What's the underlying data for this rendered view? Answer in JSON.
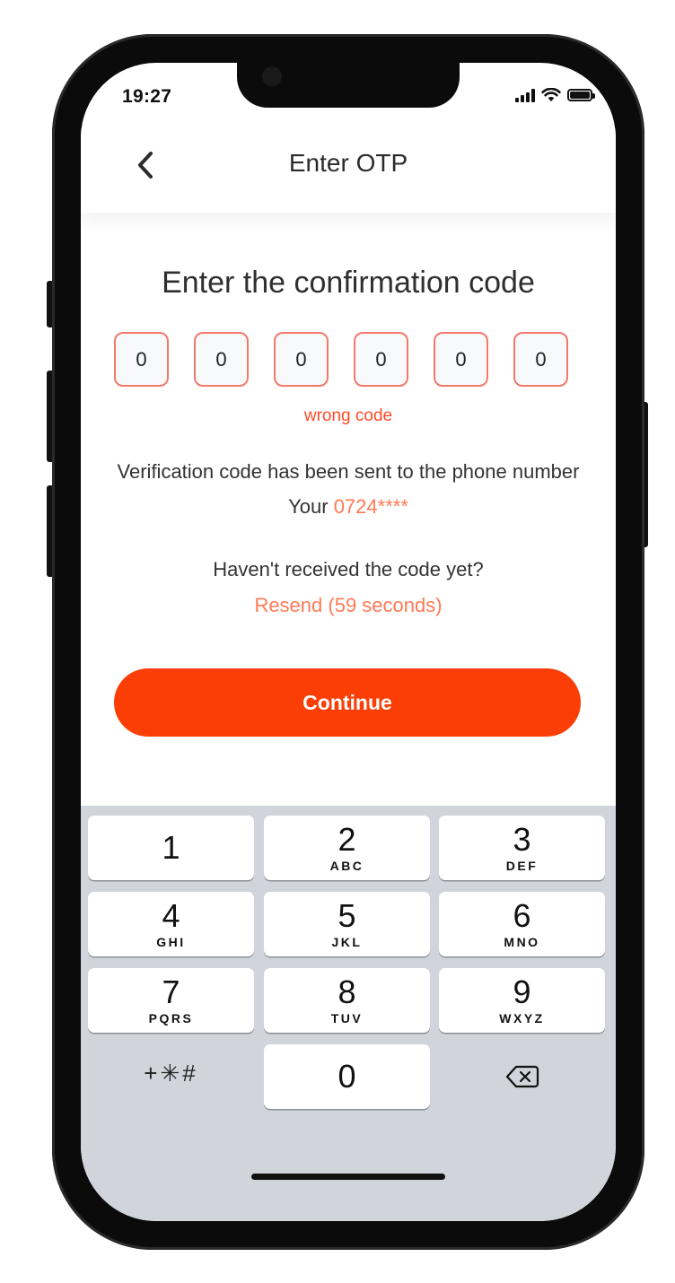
{
  "status_bar": {
    "time": "19:27"
  },
  "nav": {
    "title": "Enter OTP",
    "back_icon": "chevron-left-icon"
  },
  "heading": "Enter the confirmation code",
  "otp": {
    "digits": [
      "0",
      "0",
      "0",
      "0",
      "0",
      "0"
    ],
    "border_color": "#f07a6a"
  },
  "error": "wrong code",
  "info": {
    "text": "Verification code has been sent to the phone number Your ",
    "phone": "0724****"
  },
  "resend": {
    "question": "Haven't received the code yet?",
    "link": "Resend (59 seconds)"
  },
  "continue_label": "Continue",
  "colors": {
    "accent": "#fa3e06",
    "link": "#ff7a55",
    "error": "#ff4a2a",
    "keyboard_bg": "#d1d5db"
  },
  "keypad": {
    "keys": [
      {
        "num": "1",
        "letters": ""
      },
      {
        "num": "2",
        "letters": "ABC"
      },
      {
        "num": "3",
        "letters": "DEF"
      },
      {
        "num": "4",
        "letters": "GHI"
      },
      {
        "num": "5",
        "letters": "JKL"
      },
      {
        "num": "6",
        "letters": "MNO"
      },
      {
        "num": "7",
        "letters": "PQRS"
      },
      {
        "num": "8",
        "letters": "TUV"
      },
      {
        "num": "9",
        "letters": "WXYZ"
      },
      {
        "num": "0",
        "letters": ""
      }
    ],
    "symbols": "+✳#",
    "delete_icon": "backspace-icon"
  }
}
